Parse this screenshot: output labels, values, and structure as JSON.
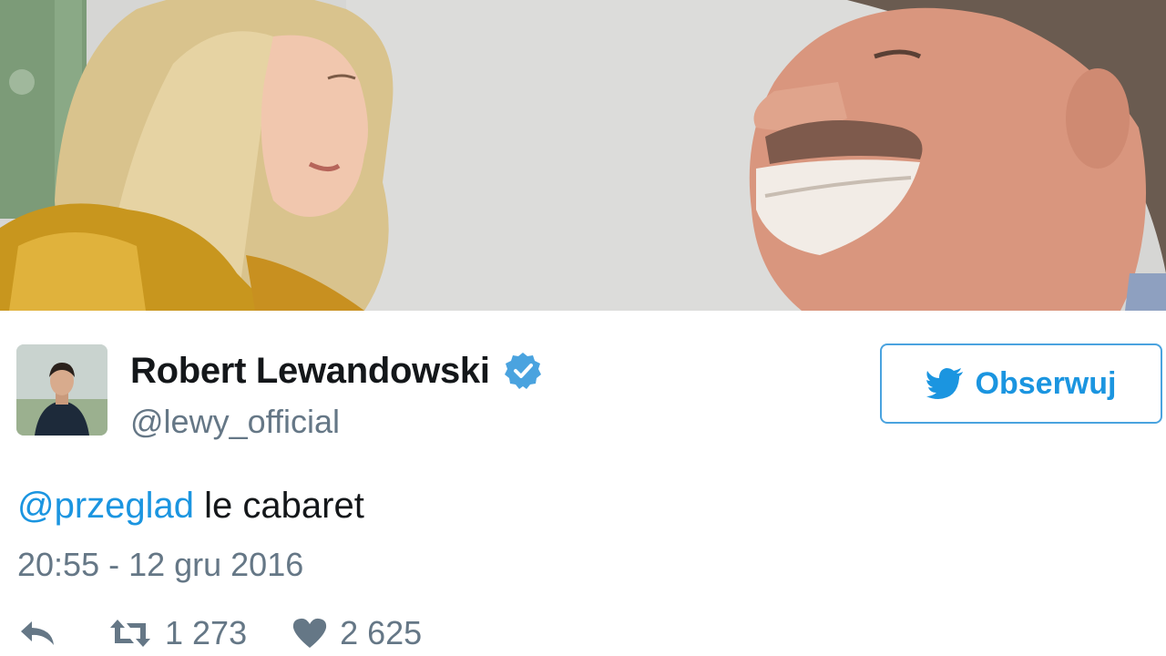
{
  "photo": {
    "icon": "tweet-photo"
  },
  "tweet": {
    "avatar_icon": "avatar",
    "display_name": "Robert Lewandowski",
    "verified_icon": "verified-badge-icon",
    "handle": "@lewy_official",
    "follow_button": {
      "label": "Obserwuj",
      "icon": "twitter-bird-icon"
    },
    "text": {
      "mention": "@przeglad",
      "body": " le cabaret"
    },
    "timestamp": "20:55 - 12 gru 2016",
    "actions": {
      "reply_icon": "reply-icon",
      "retweet_icon": "retweet-icon",
      "retweet_count": "1 273",
      "like_icon": "heart-icon",
      "like_count": "2 625"
    }
  },
  "colors": {
    "accent": "#1b95e0",
    "follow_border": "#4aa3df",
    "text_primary": "#14171a",
    "text_secondary": "#657786",
    "verified": "#4aa3df"
  }
}
